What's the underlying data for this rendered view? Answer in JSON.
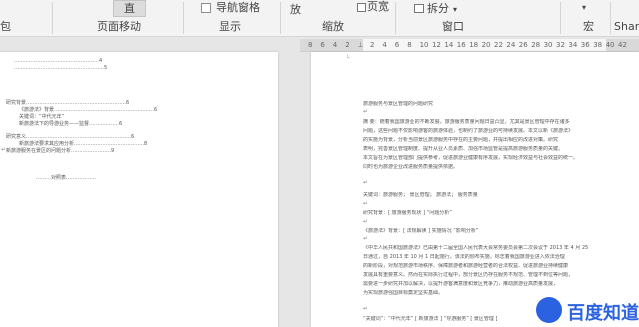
{
  "ribbon": {
    "left_partial": "包",
    "btn_single_page": "直",
    "page_move_label": "页面移动",
    "nav_pane_label": "导航窗格",
    "show_group_label": "显示",
    "zoom_short": "放",
    "page_width_label": "页宽",
    "zoom_group_label": "缩放",
    "split_label": "拆分",
    "window_group_label": "窗口",
    "macro_group_label": "宏",
    "share_partial": "Shar"
  },
  "ruler": {
    "ticks": [
      "8",
      "6",
      "4",
      "2",
      "",
      "2",
      "4",
      "6",
      "8",
      "10",
      "12",
      "14",
      "16",
      "18",
      "20",
      "22",
      "24",
      "26",
      "28",
      "30",
      "32",
      "34",
      "36",
      "38",
      "40",
      "42"
    ]
  },
  "left_page": {
    "top_lines": [
      "……………………………………………4",
      "………………………………………………5"
    ],
    "toc": [
      "研究背景……………………………………………………6",
      "《旅游法》背景……………………………………………………6",
      "关键词：“中代元年”",
      "新旅游法下的导游业务——监督………………6",
      "研究意义………………………………………………………6",
      "新旅游法要求其应用分析……………………………………8",
      "新旅游服务在景区的问题分析……………………9"
    ],
    "footer": "………对照表………………"
  },
  "right_page": {
    "title": "旅游服务与景区管理的问题研究",
    "intro": [
      "摘 要：随着我国旅游业的不断发展，旅游服务质量问题日益凸显，尤其是景区管理中存在诸多",
      "问题，这些问题不仅影响游客的旅游体验，也制约了旅游业的可持续发展。本文以新《旅游法》",
      "的实施为背景，分析当前景区旅游服务中存在的主要问题，并提出相应的改进对策。研究",
      "表明，完善景区管理制度、提升从业人员素质、加强市场监管是提高旅游服务质量的关键。",
      "本文旨在为景区管理部门提供参考，促进旅游业健康有序发展，实现经济效益与社会效益的统一。",
      "同时也为旅游企业改进服务质量提供依据。"
    ],
    "keywords": "关键词：旅游服务；  景区管理；  旅游法；  服务质量",
    "subhead1": "研究背景：[ 旅游服务现状 ]  “问题分析”",
    "subhead2": "《旅游法》背景：[ 法规解读 ]  实施情况  “影响分析”",
    "para2": [
      "《中华人民共和国旅游法》已由第十二届全国人民代表大会常务委员会第二次会议于 2013 年 4 月 25",
      "日通过，自 2013 年 10 月 1 日起施行。该法的颁布实施，标志着我国旅游业进入依法治理",
      "的新阶段，对规范旅游市场秩序、保障旅游者和旅游经营者的合法权益、促进旅游业持续健康",
      "发展具有重要意义。然而在实际执行过程中，部分景区仍存在服务不规范、管理不到位等问题，",
      "需要进一步研究并加以解决，以提升游客满意度和景区竞争力，推动旅游业高质量发展，",
      "为实现旅游强国目标奠定坚实基础。"
    ],
    "last_line": "“关键词”：“中代元年”  [ 新旅游法 ]  “导游服务”  [ 景区管理 ]"
  },
  "watermark": {
    "text": "百度知道"
  }
}
